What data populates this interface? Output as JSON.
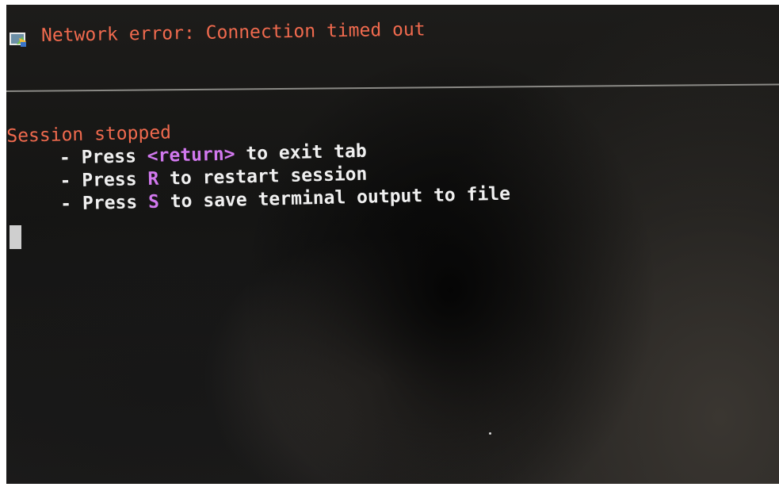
{
  "titlebar": {
    "icon": "terminal-network-error-icon",
    "text": "Network error: Connection timed out"
  },
  "terminal": {
    "status": "Session stopped",
    "lines": [
      {
        "dash": "-",
        "before": "Press",
        "key": "<return>",
        "after": "to exit tab"
      },
      {
        "dash": "-",
        "before": "Press",
        "key": "R",
        "after": "to restart session"
      },
      {
        "dash": "-",
        "before": "Press",
        "key": "S",
        "after": "to save terminal output to file"
      }
    ]
  },
  "colors": {
    "error_text": "#f06a4e",
    "key_highlight": "#d178ee",
    "body_text": "#f0f0f0",
    "cursor": "#cfcfcf"
  }
}
